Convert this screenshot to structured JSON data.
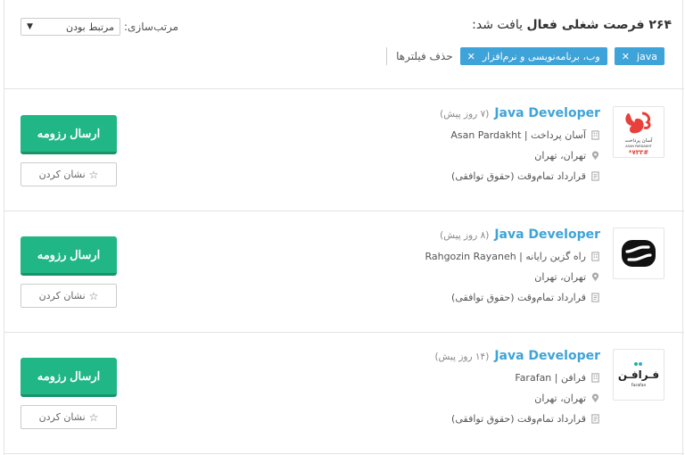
{
  "header": {
    "result_count": "۲۶۴ فرصت شغلی فعال",
    "result_suffix": "یافت شد:",
    "sort_label": "مرتب‌سازی:",
    "sort_value": "مرتبط بودن",
    "clear_filters": "حذف فیلترها",
    "filters": [
      {
        "label": "java"
      },
      {
        "label": "وب، برنامه‌نویسی و نرم‌افزار"
      }
    ]
  },
  "jobs": [
    {
      "title": "Java Developer",
      "posted": "(۷ روز پیش)",
      "company": "آسان پرداخت | Asan Pardakht",
      "location": "تهران، تهران",
      "contract": "قرارداد تمام‌وقت (حقوق توافقی)",
      "apply_label": "ارسال رزومه",
      "bookmark_label": "نشان کردن",
      "logo_text": "آسان پرداخت",
      "logo_sub": "ASAN PARDAKHT",
      "logo_code": "*۷۳۳#"
    },
    {
      "title": "Java Developer",
      "posted": "(۸ روز پیش)",
      "company": "راه گزین رایانه | Rahgozin Rayaneh",
      "location": "تهران، تهران",
      "contract": "قرارداد تمام‌وقت (حقوق توافقی)",
      "apply_label": "ارسال رزومه",
      "bookmark_label": "نشان کردن"
    },
    {
      "title": "Java Developer",
      "posted": "(۱۴ روز پیش)",
      "company": "فرافن | Farafan",
      "location": "تهران، تهران",
      "contract": "قرارداد تمام‌وقت (حقوق توافقی)",
      "apply_label": "ارسال رزومه",
      "bookmark_label": "نشان کردن",
      "logo_text": "فـرافـن",
      "logo_sub": "Farafan"
    }
  ],
  "colors": {
    "accent_blue": "#3ea3d8",
    "apply_green": "#20b685",
    "logo_red": "#e8403a"
  },
  "icons": {
    "building": "building-icon",
    "location": "map-pin-icon",
    "contract": "document-icon",
    "star": "star-outline-icon",
    "remove": "close-icon"
  }
}
